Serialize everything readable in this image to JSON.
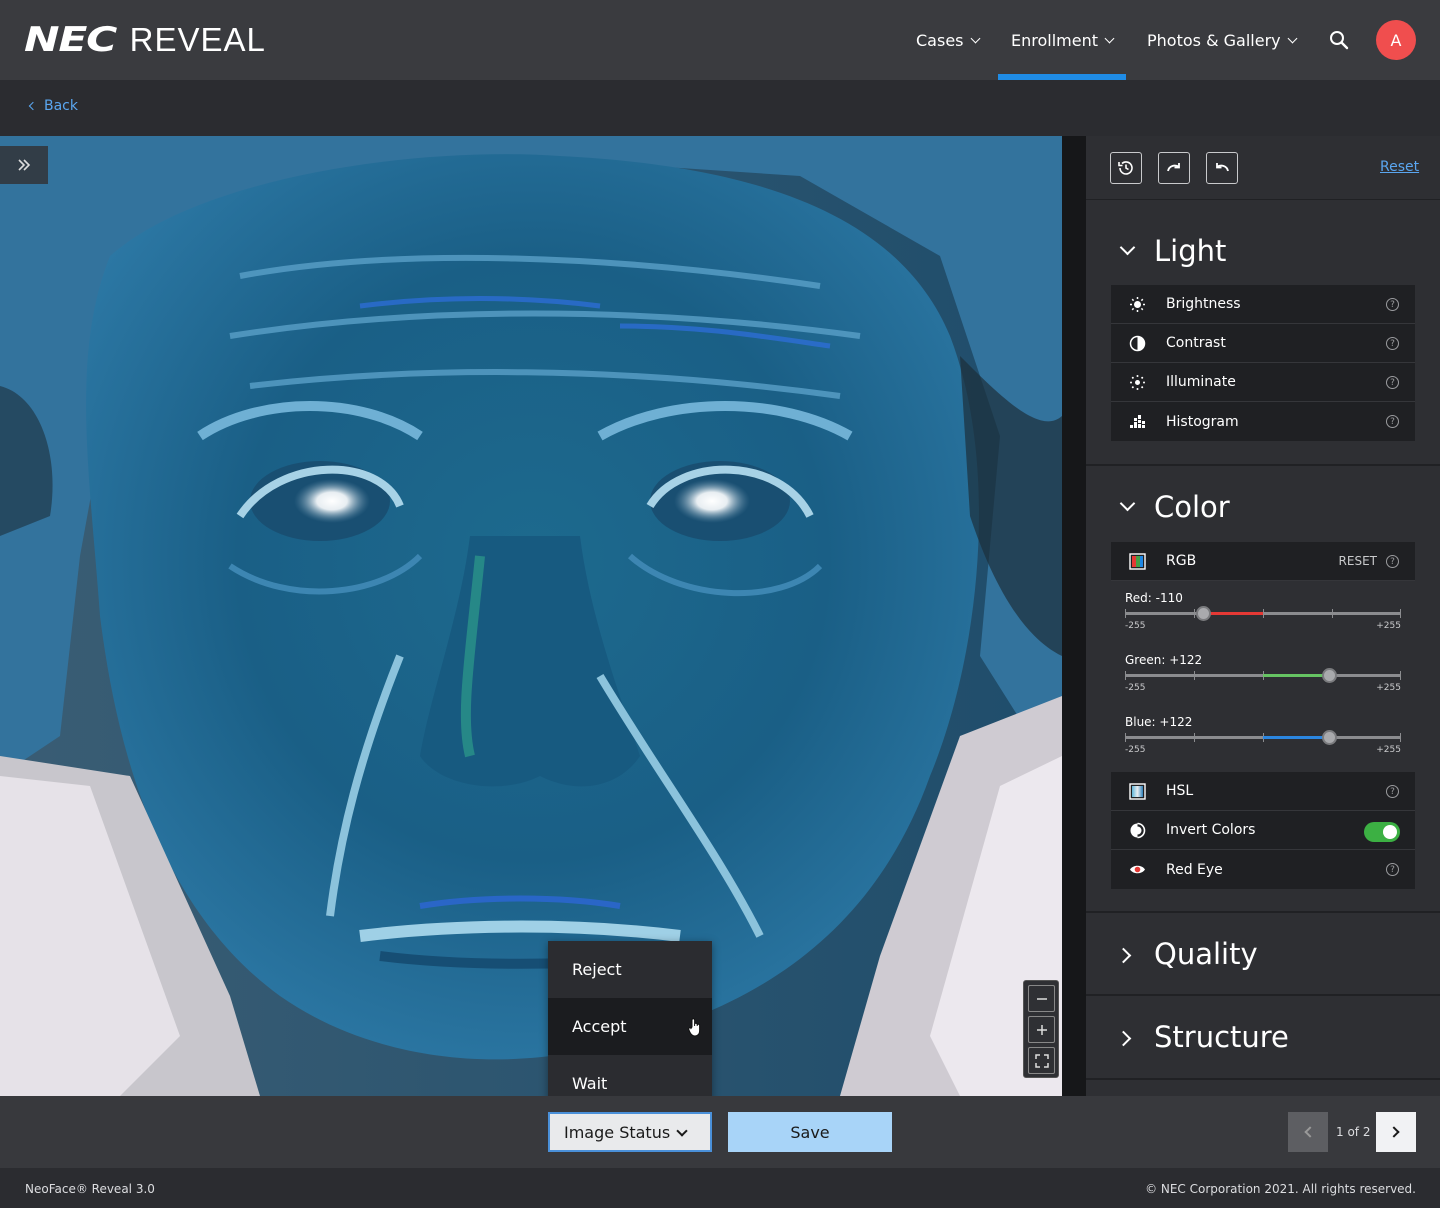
{
  "app": {
    "logo_brand": "NEC",
    "logo_product": "REVEAL"
  },
  "nav": {
    "items": [
      {
        "label": "Cases"
      },
      {
        "label": "Enrollment"
      },
      {
        "label": "Photos & Gallery"
      }
    ],
    "active": "Enrollment",
    "avatar_initial": "A",
    "accent_color": "#1f8ce6",
    "avatar_color": "#f04e4e"
  },
  "back_label": "Back",
  "panel": {
    "reset_label": "Reset",
    "toolbar_icons": [
      "history-icon",
      "redo-icon",
      "undo-icon"
    ],
    "sections": {
      "light": {
        "title": "Light",
        "tools": [
          {
            "label": "Brightness",
            "icon": "sun-icon"
          },
          {
            "label": "Contrast",
            "icon": "contrast-icon"
          },
          {
            "label": "Illuminate",
            "icon": "illuminate-icon"
          },
          {
            "label": "Histogram",
            "icon": "histogram-icon"
          }
        ]
      },
      "color": {
        "title": "Color",
        "rgb": {
          "label": "RGB",
          "reset_label": "RESET",
          "red": {
            "label": "Red: -110",
            "value": -110,
            "min_label": "-255",
            "max_label": "+255"
          },
          "green": {
            "label": "Green: +122",
            "value": 122,
            "min_label": "-255",
            "max_label": "+255"
          },
          "blue": {
            "label": "Blue: +122",
            "value": 122,
            "min_label": "-255",
            "max_label": "+255"
          }
        },
        "hsl": {
          "label": "HSL"
        },
        "invert": {
          "label": "Invert Colors",
          "enabled": true
        },
        "red_eye": {
          "label": "Red Eye"
        }
      },
      "quality": {
        "title": "Quality"
      },
      "structure": {
        "title": "Structure"
      }
    }
  },
  "status_menu": {
    "options": [
      "Reject",
      "Accept",
      "Wait"
    ],
    "hovered": "Accept",
    "button_label": "Image Status"
  },
  "save_label": "Save",
  "pagination": {
    "text": "1 of 2",
    "current": 1,
    "total": 2
  },
  "footer": {
    "left": "NeoFace® Reveal 3.0",
    "right": "© NEC Corporation 2021. All rights reserved."
  }
}
